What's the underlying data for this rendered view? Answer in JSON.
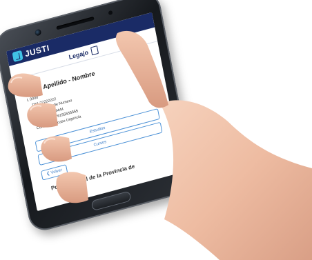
{
  "app": {
    "logo_text": "JUSTI",
    "header_title": "Legajo"
  },
  "profile": {
    "name": "Titulo Apellido - Nombre",
    "fields": [
      "L 0000",
      "DNI-22222222",
      "Direccion Calle Numero",
      "TUD 3764444444",
      "CELULAR 376155555555",
      "Contacto en caso Urgencia"
    ]
  },
  "buttons": {
    "estudios": "Estudios",
    "cursos": "Cursos",
    "volver": "❮ Volver"
  },
  "footer": "Poder Judicial de la Provincia de",
  "colors": {
    "appbar": "#1a2b66",
    "accent": "#41c3e6",
    "button_border": "#4a90d6"
  }
}
